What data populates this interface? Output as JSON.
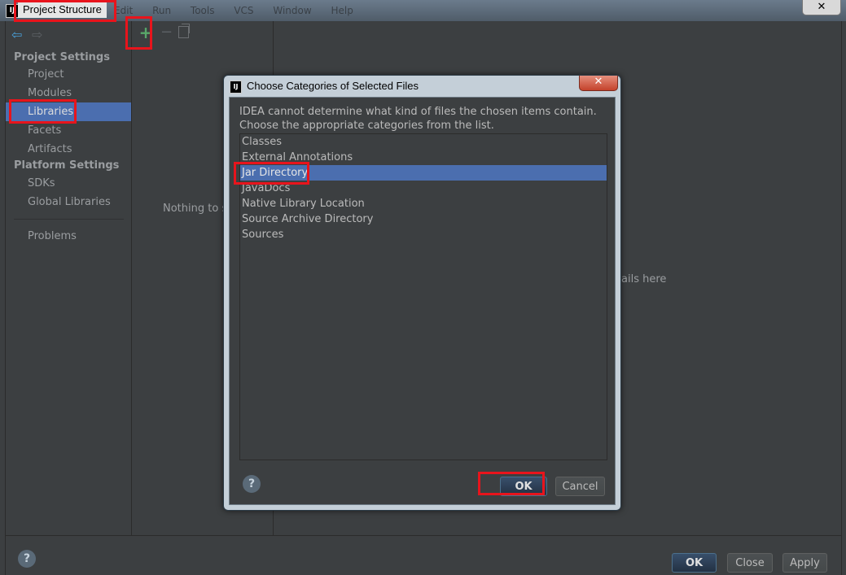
{
  "window": {
    "title": "Project Structure",
    "app_icon": "IJ",
    "close_glyph": "✕",
    "menu_ghost": [
      "Edit",
      "Run",
      "Tools",
      "VCS",
      "Window",
      "Help"
    ]
  },
  "sidebar": {
    "back_glyph": "⇦",
    "forward_glyph": "⇨",
    "project_settings_header": "Project Settings",
    "project_items": [
      "Project",
      "Modules",
      "Libraries",
      "Facets",
      "Artifacts"
    ],
    "platform_settings_header": "Platform Settings",
    "platform_items": [
      "SDKs",
      "Global Libraries"
    ],
    "problems": "Problems",
    "selected": "Libraries"
  },
  "toolbar": {
    "add_glyph": "+",
    "remove_glyph": "−"
  },
  "main": {
    "nothing_text": "Nothing to s",
    "details_text": "ails here"
  },
  "footer": {
    "help_glyph": "?",
    "ok": "OK",
    "close": "Close",
    "apply": "Apply"
  },
  "dialog": {
    "title": "Choose Categories of Selected Files",
    "icon": "IJ",
    "close_glyph": "✕",
    "message_line1": "IDEA cannot determine what kind of files the chosen items contain.",
    "message_line2": "Choose the appropriate categories from the list.",
    "categories": [
      "Classes",
      "External Annotations",
      "Jar Directory",
      "JavaDocs",
      "Native Library Location",
      "Source Archive Directory",
      "Sources"
    ],
    "selected": "Jar Directory",
    "help_glyph": "?",
    "ok": "OK",
    "cancel": "Cancel"
  },
  "colors": {
    "background": "#3c3f41",
    "selection": "#4b6eaf",
    "highlight": "#e8141c",
    "add_icon": "#59a869"
  }
}
